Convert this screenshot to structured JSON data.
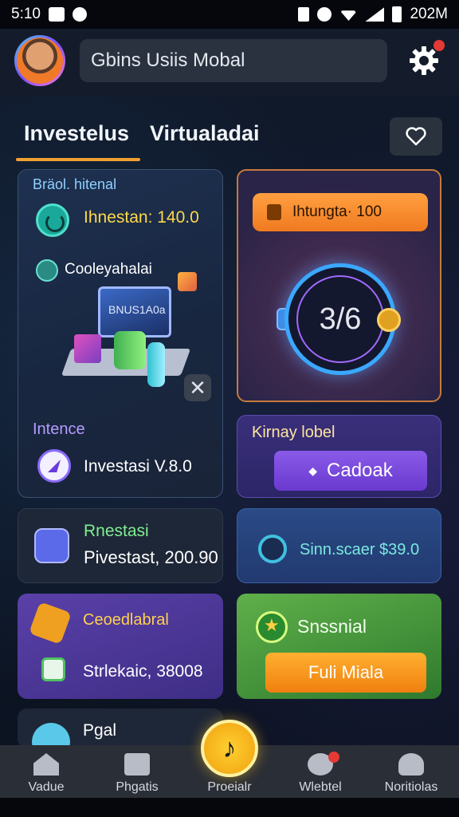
{
  "status_bar": {
    "time": "5:10",
    "right_text": "202M"
  },
  "header": {
    "title": "Gbins Usiis Mobal"
  },
  "tabs": [
    {
      "label": "Investelus"
    },
    {
      "label": "Virtualadai"
    }
  ],
  "cards": {
    "a": {
      "title": "Bräol. hitenal",
      "value1": "Ihnestan: 140.0",
      "label2": "Cooleyahalai",
      "screen_text": "BNUS1A0a",
      "title2": "Intence",
      "value3": "Investasi V.8.0"
    },
    "b": {
      "pill": "Ihtungta· 100",
      "ring_text": "3/6"
    },
    "c": {
      "title": "Kirnay lobel",
      "button_label": "Cadoak"
    },
    "d": {
      "title": "Rnestasi",
      "value": "Pivestast, 200.90"
    },
    "e": {
      "value": "Sinn.scaer $39.0"
    },
    "f": {
      "title": "Ceoedlabral",
      "value": "Strlekaic, 38008"
    },
    "g": {
      "title": "Snssnial",
      "button_label": "Fuli Miala"
    },
    "h": {
      "title": "Pgal"
    }
  },
  "bottom_nav": [
    {
      "label": "Vadue"
    },
    {
      "label": "Phgatis"
    },
    {
      "label": "Proeialr"
    },
    {
      "label": "Wlebtel"
    },
    {
      "label": "Noritiolas"
    }
  ],
  "colors": {
    "accent": "#f0a030",
    "background": "#0d1524",
    "alert": "#e53935"
  }
}
